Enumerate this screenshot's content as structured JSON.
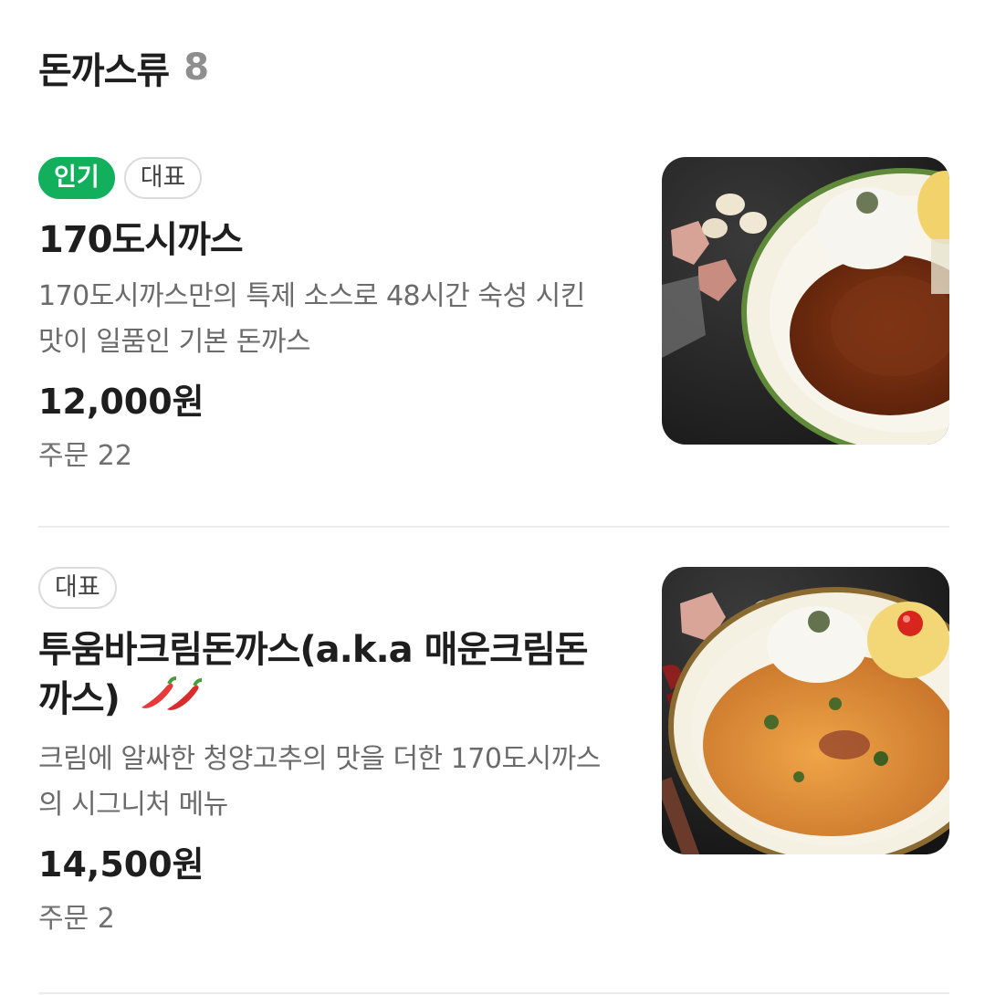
{
  "section": {
    "title": "돈까스류",
    "count": "8"
  },
  "items": [
    {
      "badges": [
        "인기",
        "대표"
      ],
      "name": "170도시까스",
      "description": "170도시까스만의 특제 소스로 48시간 숙성 시킨 맛이 일품인 기본 돈까스",
      "price": "12,000원",
      "orders": "주문 22"
    },
    {
      "badges": [
        "대표"
      ],
      "name": "투움바크림돈까스(a.k.a 매운크림돈까스)",
      "spicy_level": 2,
      "description": "크림에 알싸한 청양고추의 맛을 더한 170도시까스의 시그니처 메뉴",
      "price": "14,500원",
      "orders": "주문 2"
    }
  ],
  "colors": {
    "popular_badge": "#12b05d",
    "chili": "#e83a3a"
  }
}
